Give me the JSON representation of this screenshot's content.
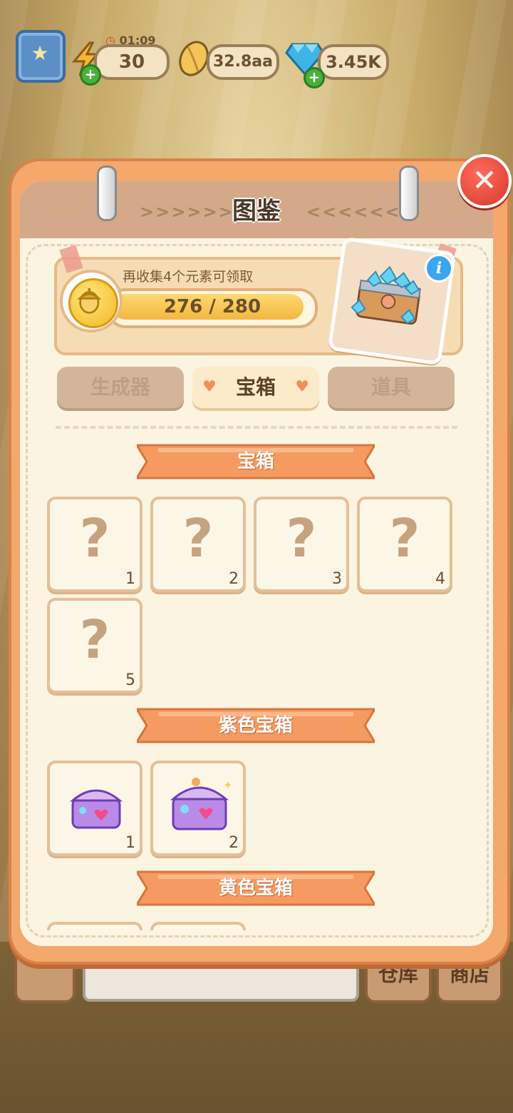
{
  "hud": {
    "energy": {
      "timer": "01:09",
      "value": "30"
    },
    "seeds": {
      "value": "32.8aa"
    },
    "gems": {
      "value": "3.45K"
    }
  },
  "panel": {
    "title": "图鉴",
    "arrows_left": ">>>>>>",
    "arrows_right": "<<<<<<",
    "close_symbol": "✕"
  },
  "reward": {
    "message": "再收集4个元素可领取",
    "progress_text": "276 / 280",
    "progress_current": 276,
    "progress_total": 280,
    "info_symbol": "i"
  },
  "tabs": [
    {
      "label": "生成器",
      "active": false
    },
    {
      "label": "宝箱",
      "active": true
    },
    {
      "label": "道具",
      "active": false
    }
  ],
  "sections": [
    {
      "title": "宝箱",
      "slots": [
        {
          "number": "1",
          "unknown": true
        },
        {
          "number": "2",
          "unknown": true
        },
        {
          "number": "3",
          "unknown": true
        },
        {
          "number": "4",
          "unknown": true
        },
        {
          "number": "5",
          "unknown": true
        }
      ]
    },
    {
      "title": "紫色宝箱",
      "slots": [
        {
          "number": "1",
          "unknown": false
        },
        {
          "number": "2",
          "unknown": false
        }
      ]
    },
    {
      "title": "黄色宝箱",
      "slots": []
    }
  ],
  "unknown_symbol": "?",
  "bottom": {
    "warehouse": "仓库",
    "shop": "商店"
  },
  "colors": {
    "accent": "#f5a86c",
    "banner": "#f59b62",
    "close": "#e0443a",
    "info": "#3aa6f2"
  }
}
